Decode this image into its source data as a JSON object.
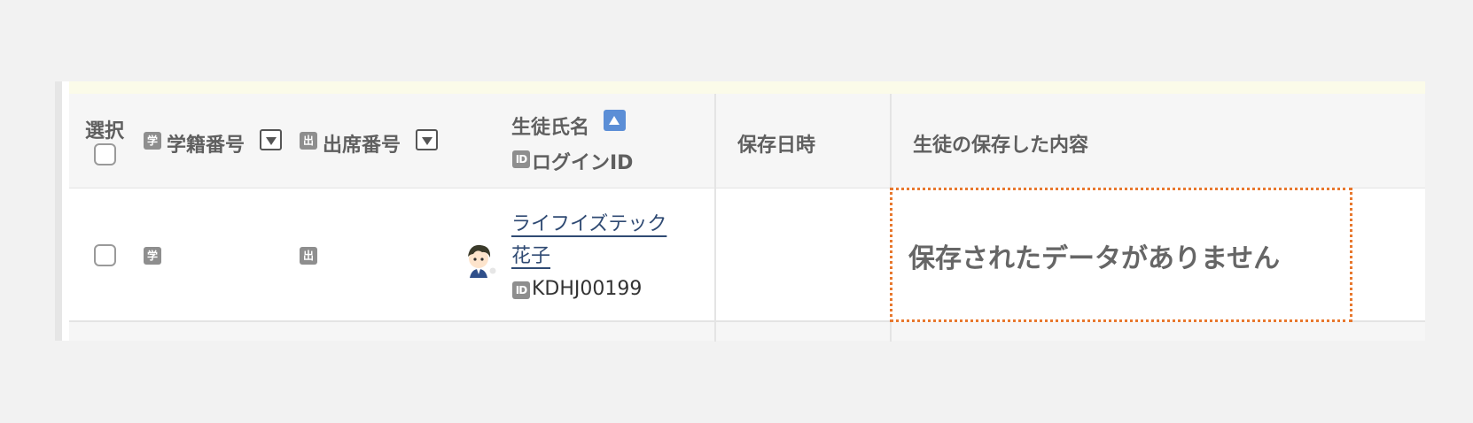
{
  "table": {
    "headers": {
      "select": "選択",
      "student_number": "学籍番号",
      "student_number_badge": "学",
      "attendance_number": "出席番号",
      "attendance_number_badge": "出",
      "student_name": "生徒氏名",
      "login_id": "ログインID",
      "login_id_badge": "ID",
      "saved_datetime": "保存日時",
      "saved_content": "生徒の保存した内容"
    },
    "rows": [
      {
        "student_number_badge": "学",
        "attendance_number_badge": "出",
        "name": "ライフイズテック 花子",
        "login_id_badge": "ID",
        "login_id": "KDHJ00199",
        "saved_datetime": "",
        "saved_content": "保存されたデータがありません"
      }
    ]
  },
  "colors": {
    "accent_sort": "#5b8ed6",
    "link": "#2f4a73",
    "empty_highlight": "#e8782e",
    "header_bg": "#f6f6f6",
    "notice_strip": "#fbfbe9"
  },
  "icons": {
    "sort_active": "triangle-up-icon",
    "sort_inactive": "triangle-down-icon",
    "avatar": "student-avatar-icon"
  }
}
